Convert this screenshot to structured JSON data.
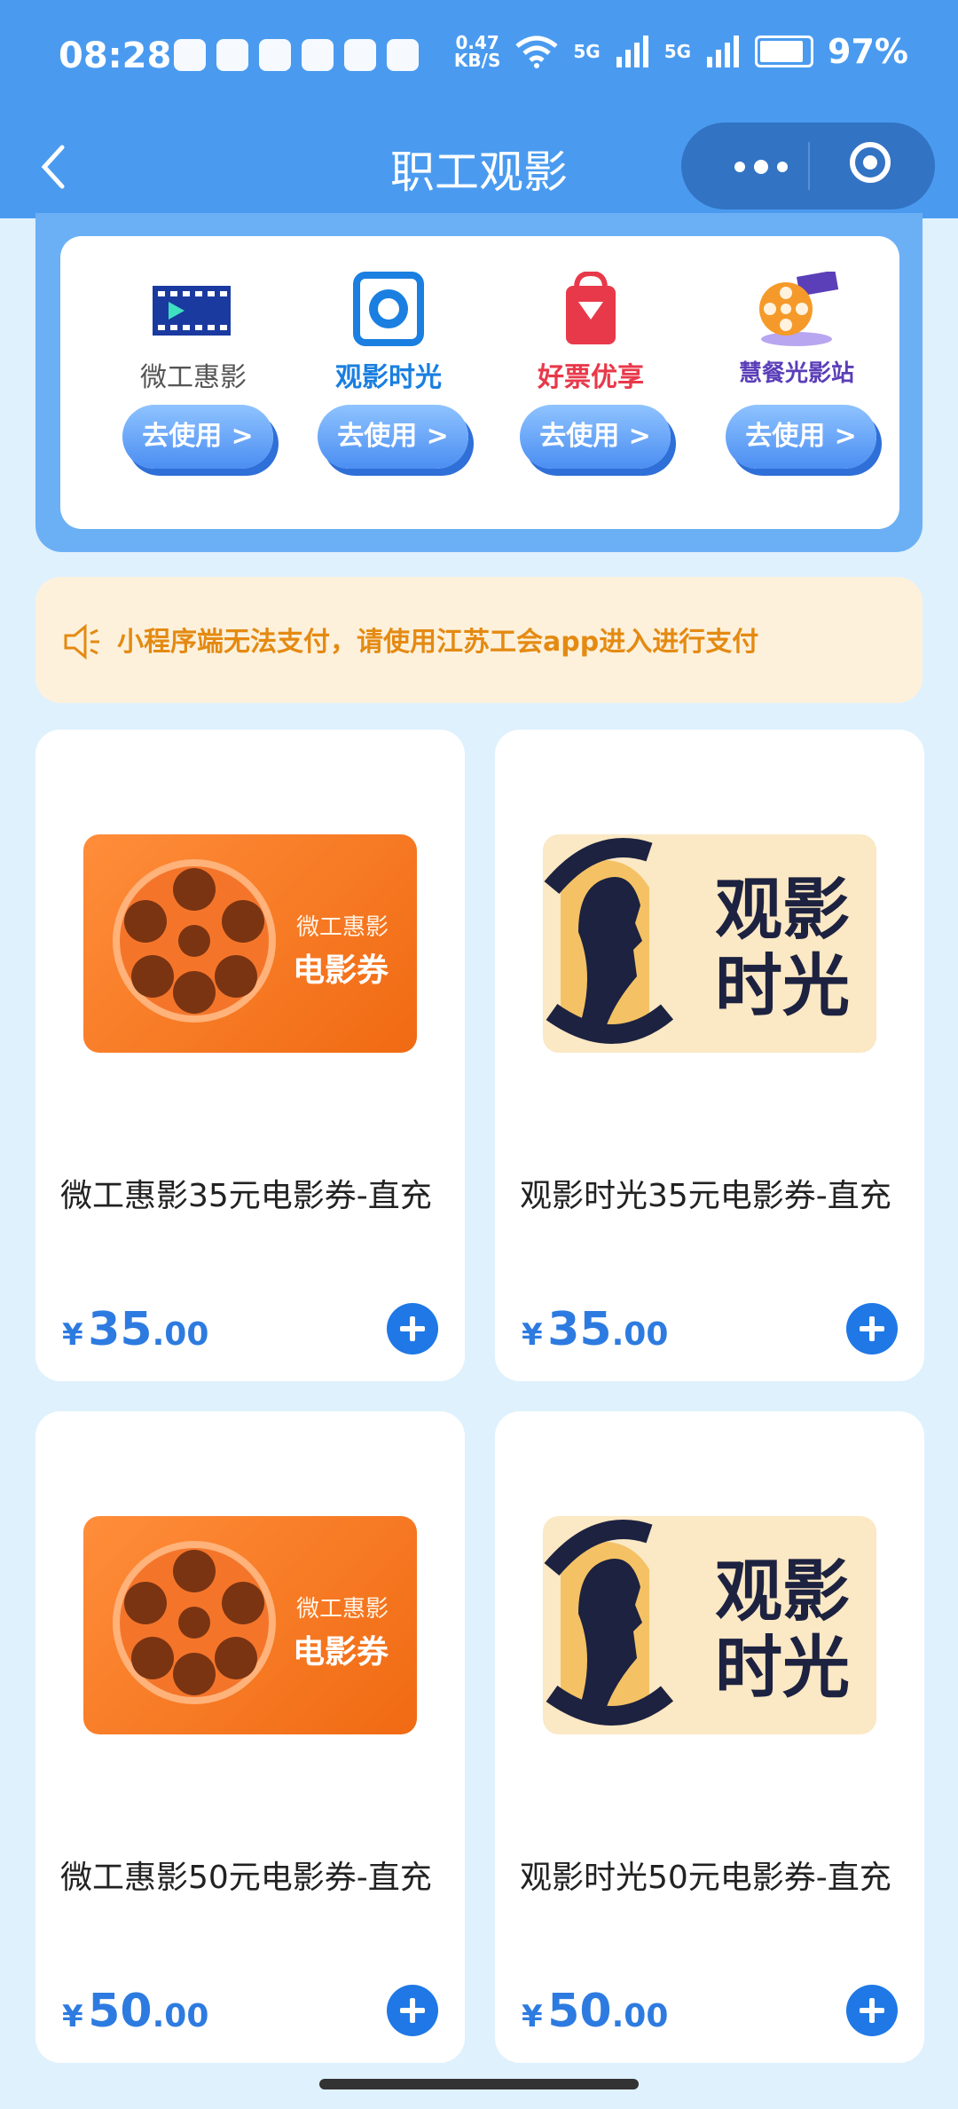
{
  "status_bar": {
    "time": "08:28",
    "net_speed_value": "0.47",
    "net_speed_unit": "KB/S",
    "battery": "97%",
    "signal_1": "5G",
    "signal_2": "5G"
  },
  "nav": {
    "title": "职工观影",
    "back_icon": "chevron-left-icon",
    "more_icon": "more-dots-icon",
    "close_icon": "target-circle-icon"
  },
  "brands": [
    {
      "name": "微工惠影",
      "button": "去使用 >",
      "color": "#555555"
    },
    {
      "name": "观影时光",
      "button": "去使用 >",
      "color": "#1a7fe0"
    },
    {
      "name": "好票优享",
      "button": "去使用 >",
      "color": "#e8394a"
    },
    {
      "name": "慧餐光影站",
      "button": "去使用 >",
      "color": "#5b3fb8"
    }
  ],
  "notice": {
    "icon": "speaker-icon",
    "text": "小程序端无法支付，请使用江苏工会app进入进行支付"
  },
  "products": [
    {
      "title": "微工惠影35元电影券-直充",
      "thumb_small": "微工惠影",
      "thumb_big": "电影券",
      "price_symbol": "¥",
      "price_int": "35",
      "price_dec": ".00"
    },
    {
      "title": "观影时光35元电影券-直充",
      "thumb_line1": "观影",
      "thumb_line2": "时光",
      "price_symbol": "¥",
      "price_int": "35",
      "price_dec": ".00"
    },
    {
      "title": "微工惠影50元电影券-直充",
      "thumb_small": "微工惠影",
      "thumb_big": "电影券",
      "price_symbol": "¥",
      "price_int": "50",
      "price_dec": ".00"
    },
    {
      "title": "观影时光50元电影券-直充",
      "thumb_line1": "观影",
      "thumb_line2": "时光",
      "price_symbol": "¥",
      "price_int": "50",
      "price_dec": ".00"
    }
  ],
  "colors": {
    "primary": "#4a9bf0",
    "price": "#2d7be0",
    "notice_text": "#e48a12"
  }
}
